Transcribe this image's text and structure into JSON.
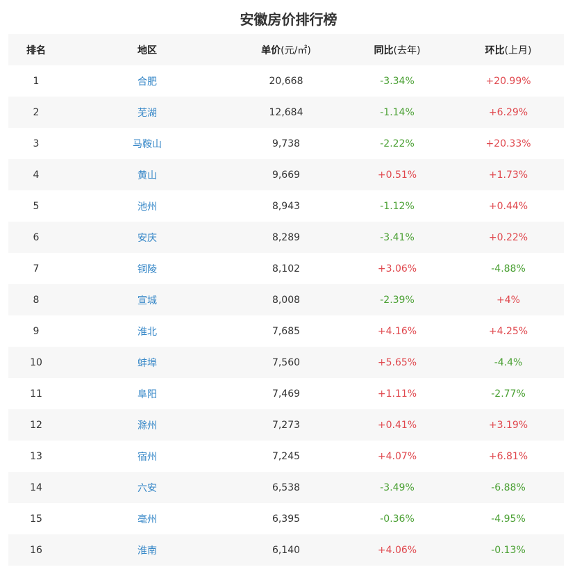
{
  "title": "安徽房价排行榜",
  "header": {
    "rank": "排名",
    "region": "地区",
    "price_main": "单价",
    "price_sub": "(元/㎡)",
    "yoy_main": "同比",
    "yoy_sub": "(去年)",
    "mom_main": "环比",
    "mom_sub": "(上月)"
  },
  "rows": [
    {
      "rank": "1",
      "region": "合肥",
      "price": "20,668",
      "yoy": "-3.34%",
      "mom": "+20.99%"
    },
    {
      "rank": "2",
      "region": "芜湖",
      "price": "12,684",
      "yoy": "-1.14%",
      "mom": "+6.29%"
    },
    {
      "rank": "3",
      "region": "马鞍山",
      "price": "9,738",
      "yoy": "-2.22%",
      "mom": "+20.33%"
    },
    {
      "rank": "4",
      "region": "黄山",
      "price": "9,669",
      "yoy": "+0.51%",
      "mom": "+1.73%"
    },
    {
      "rank": "5",
      "region": "池州",
      "price": "8,943",
      "yoy": "-1.12%",
      "mom": "+0.44%"
    },
    {
      "rank": "6",
      "region": "安庆",
      "price": "8,289",
      "yoy": "-3.41%",
      "mom": "+0.22%"
    },
    {
      "rank": "7",
      "region": "铜陵",
      "price": "8,102",
      "yoy": "+3.06%",
      "mom": "-4.88%"
    },
    {
      "rank": "8",
      "region": "宣城",
      "price": "8,008",
      "yoy": "-2.39%",
      "mom": "+4%"
    },
    {
      "rank": "9",
      "region": "淮北",
      "price": "7,685",
      "yoy": "+4.16%",
      "mom": "+4.25%"
    },
    {
      "rank": "10",
      "region": "蚌埠",
      "price": "7,560",
      "yoy": "+5.65%",
      "mom": "-4.4%"
    },
    {
      "rank": "11",
      "region": "阜阳",
      "price": "7,469",
      "yoy": "+1.11%",
      "mom": "-2.77%"
    },
    {
      "rank": "12",
      "region": "滁州",
      "price": "7,273",
      "yoy": "+0.41%",
      "mom": "+3.19%"
    },
    {
      "rank": "13",
      "region": "宿州",
      "price": "7,245",
      "yoy": "+4.07%",
      "mom": "+6.81%"
    },
    {
      "rank": "14",
      "region": "六安",
      "price": "6,538",
      "yoy": "-3.49%",
      "mom": "-6.88%"
    },
    {
      "rank": "15",
      "region": "亳州",
      "price": "6,395",
      "yoy": "-0.36%",
      "mom": "-4.95%"
    },
    {
      "rank": "16",
      "region": "淮南",
      "price": "6,140",
      "yoy": "+4.06%",
      "mom": "-0.13%"
    }
  ],
  "colors": {
    "up": "#e0484e",
    "down": "#4aa033",
    "link": "#3486c7",
    "stripe": "#f7f7f7"
  }
}
